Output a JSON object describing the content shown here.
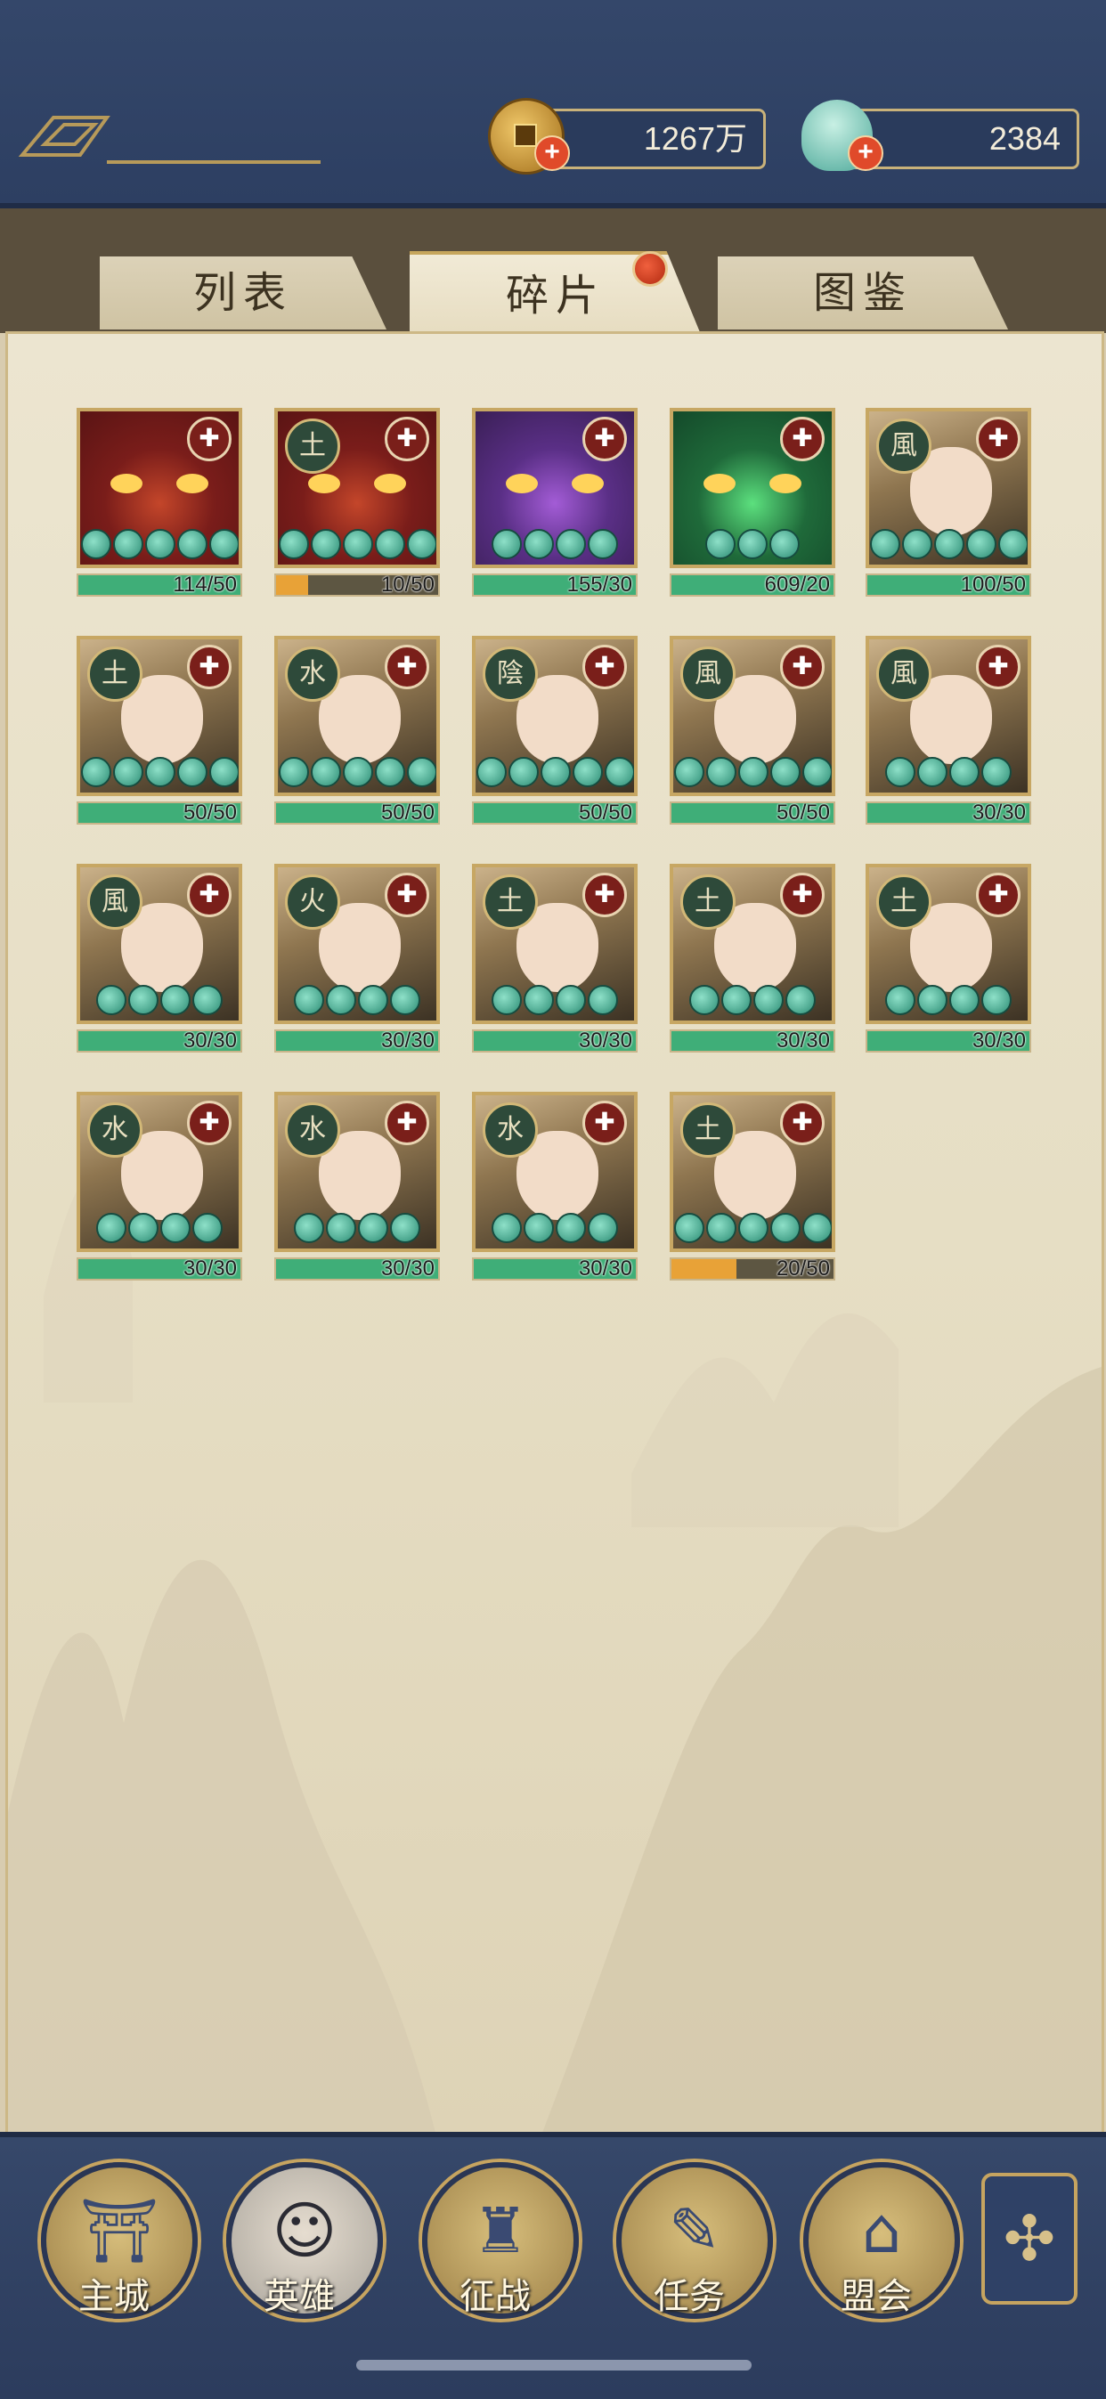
{
  "currency": {
    "coins": "1267万",
    "gems": "2384"
  },
  "tabs": [
    {
      "label": "列表"
    },
    {
      "label": "碎片"
    },
    {
      "label": "图鉴"
    }
  ],
  "active_tab": "碎片",
  "fragments": [
    {
      "progress": "114/50",
      "fill": 1.0,
      "bar_color": "green",
      "stars": 5,
      "element": "",
      "portrait": "red-mask"
    },
    {
      "progress": "10/50",
      "fill": 0.2,
      "bar_color": "orange",
      "stars": 5,
      "element": "土",
      "portrait": "red-mask"
    },
    {
      "progress": "155/30",
      "fill": 1.0,
      "bar_color": "green",
      "stars": 4,
      "element": "",
      "portrait": "purple-mask"
    },
    {
      "progress": "609/20",
      "fill": 1.0,
      "bar_color": "green",
      "stars": 3,
      "element": "",
      "portrait": "green-mask"
    },
    {
      "progress": "100/50",
      "fill": 1.0,
      "bar_color": "green",
      "stars": 5,
      "element": "風",
      "portrait": "hero"
    },
    {
      "progress": "50/50",
      "fill": 1.0,
      "bar_color": "green",
      "stars": 5,
      "element": "土",
      "portrait": "hero"
    },
    {
      "progress": "50/50",
      "fill": 1.0,
      "bar_color": "green",
      "stars": 5,
      "element": "水",
      "portrait": "hero"
    },
    {
      "progress": "50/50",
      "fill": 1.0,
      "bar_color": "green",
      "stars": 5,
      "element": "陰",
      "portrait": "hero"
    },
    {
      "progress": "50/50",
      "fill": 1.0,
      "bar_color": "green",
      "stars": 5,
      "element": "風",
      "portrait": "hero"
    },
    {
      "progress": "30/30",
      "fill": 1.0,
      "bar_color": "green",
      "stars": 4,
      "element": "風",
      "portrait": "hero"
    },
    {
      "progress": "30/30",
      "fill": 1.0,
      "bar_color": "green",
      "stars": 4,
      "element": "風",
      "portrait": "hero"
    },
    {
      "progress": "30/30",
      "fill": 1.0,
      "bar_color": "green",
      "stars": 4,
      "element": "火",
      "portrait": "hero"
    },
    {
      "progress": "30/30",
      "fill": 1.0,
      "bar_color": "green",
      "stars": 4,
      "element": "土",
      "portrait": "hero"
    },
    {
      "progress": "30/30",
      "fill": 1.0,
      "bar_color": "green",
      "stars": 4,
      "element": "土",
      "portrait": "hero"
    },
    {
      "progress": "30/30",
      "fill": 1.0,
      "bar_color": "green",
      "stars": 4,
      "element": "土",
      "portrait": "hero"
    },
    {
      "progress": "30/30",
      "fill": 1.0,
      "bar_color": "green",
      "stars": 4,
      "element": "水",
      "portrait": "hero"
    },
    {
      "progress": "30/30",
      "fill": 1.0,
      "bar_color": "green",
      "stars": 4,
      "element": "水",
      "portrait": "hero"
    },
    {
      "progress": "30/30",
      "fill": 1.0,
      "bar_color": "green",
      "stars": 4,
      "element": "水",
      "portrait": "hero"
    },
    {
      "progress": "20/50",
      "fill": 0.4,
      "bar_color": "orange",
      "stars": 5,
      "element": "土",
      "portrait": "hero"
    }
  ],
  "colors": {
    "bar_green": "#3fae78",
    "bar_orange": "#e8a237",
    "navy": "#2f4166",
    "gold": "#c7a763"
  },
  "nav": [
    {
      "label": "主城",
      "icon": "city-gate-icon"
    },
    {
      "label": "英雄",
      "icon": "hero-portrait-icon"
    },
    {
      "label": "征战",
      "icon": "battle-horn-icon"
    },
    {
      "label": "任务",
      "icon": "scroll-task-icon"
    },
    {
      "label": "盟会",
      "icon": "alliance-gate-icon"
    }
  ],
  "menu_icon": "menu-knot-icon"
}
